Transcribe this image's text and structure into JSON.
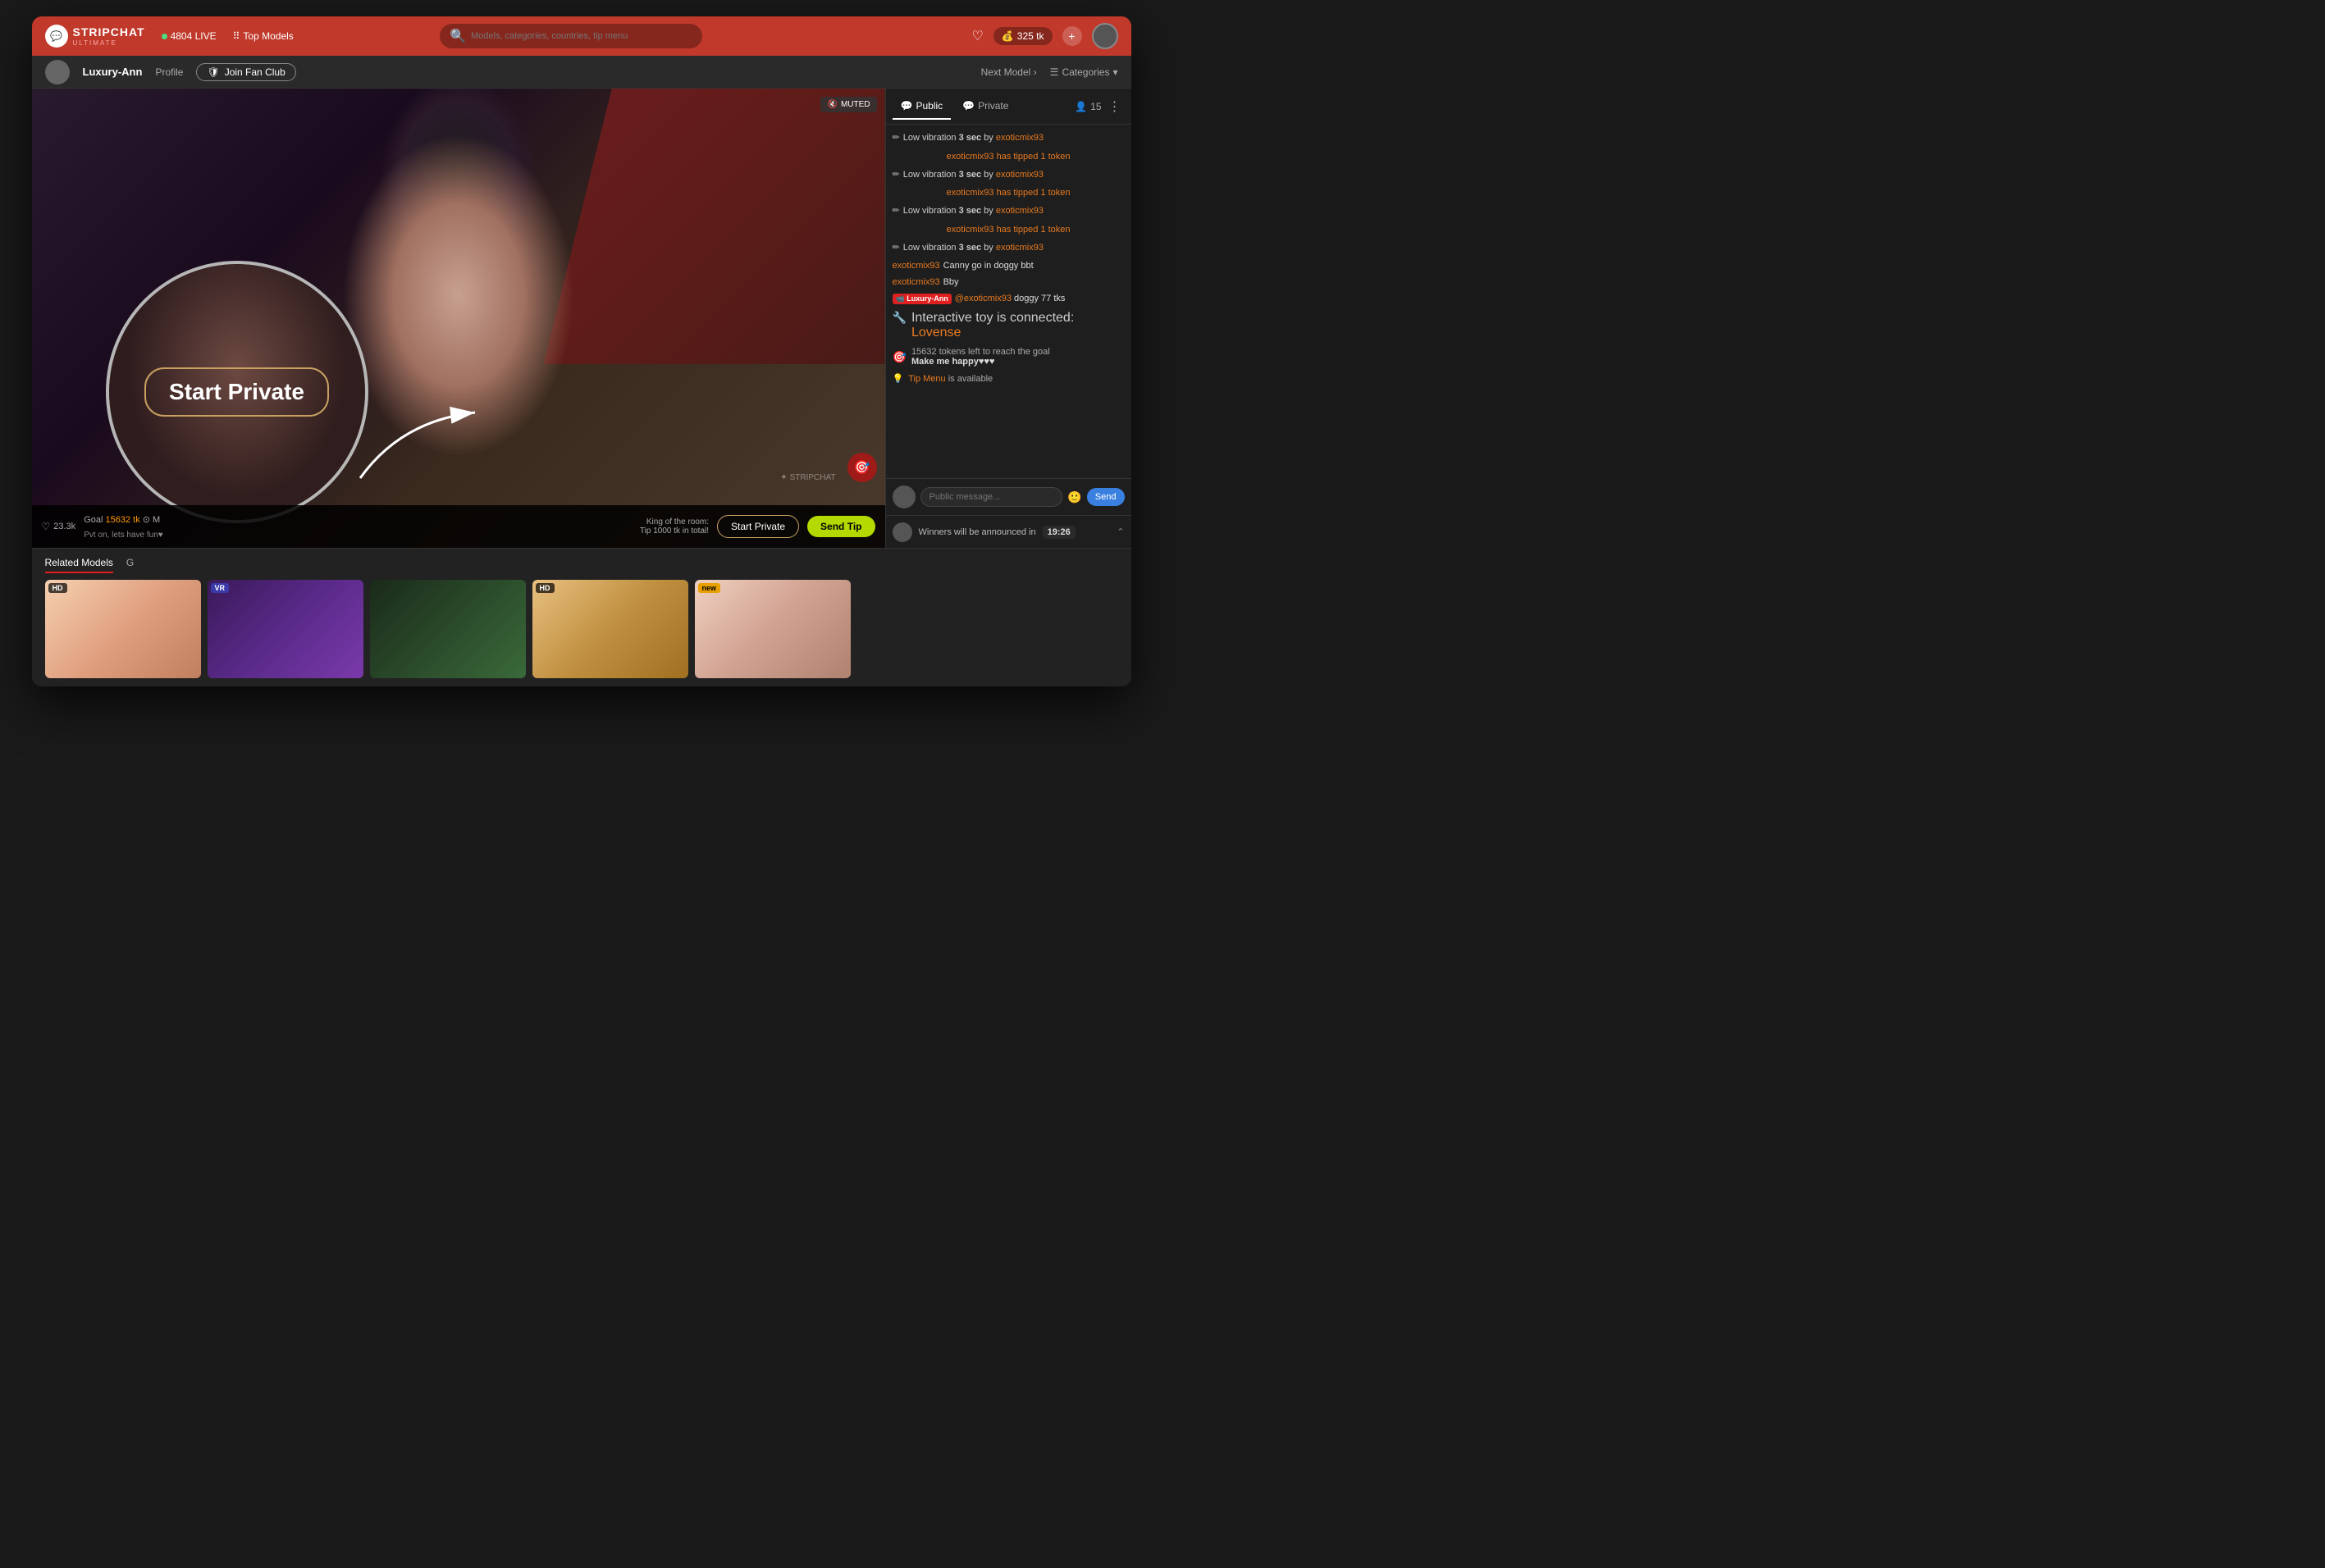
{
  "app": {
    "title": "STRIPCHAT",
    "subtitle": "ULTIMATE",
    "live_count": "4804 LIVE",
    "top_models": "Top Models",
    "search_placeholder": "Models, categories, countries, tip menu",
    "tokens": "325 tk",
    "model_name": "Luxury-Ann",
    "profile": "Profile",
    "join_fan_club": "Join Fan Club",
    "next_model": "Next Model",
    "categories": "Categories"
  },
  "video": {
    "muted_badge": "MUTED",
    "stripchat_watermark": "STRIPCHAT",
    "like_count": "23.3k",
    "goal_text": "Goal",
    "goal_tokens": "15632 tk",
    "goal_icon": "⊙ M",
    "pvt_text": "Pvt on, lets have fun♥",
    "start_private": "Start Private",
    "send_tip": "Send Tip",
    "king_line1": "King of the room:",
    "king_line2": "Tip 1000 tk in total!"
  },
  "circle_annotation": {
    "label": "Start Private"
  },
  "chat": {
    "tab_public": "Public",
    "tab_private": "Private",
    "tab_users_count": "15",
    "messages": [
      {
        "type": "vibration",
        "text": "Low vibration 3 sec by exoticmix93"
      },
      {
        "type": "tipped",
        "text": "exoticmix93 has tipped 1 token"
      },
      {
        "type": "vibration",
        "text": "Low vibration 3 sec by exoticmix93"
      },
      {
        "type": "tipped",
        "text": "exoticmix93 has tipped 1 token"
      },
      {
        "type": "vibration",
        "text": "Low vibration 3 sec by exoticmix93"
      },
      {
        "type": "tipped",
        "text": "exoticmix93 has tipped 1 token"
      },
      {
        "type": "vibration",
        "text": "Low vibration 3 sec by exoticmix93"
      },
      {
        "type": "chat",
        "user": "exoticmix93",
        "text": "Canny go in doggy bbt"
      },
      {
        "type": "chat",
        "user": "exoticmix93",
        "text": "Bby"
      },
      {
        "type": "model_chat",
        "model": "Luxury-Ann",
        "mention": "@exoticmix93",
        "text": " doggy 77 tks"
      },
      {
        "type": "system",
        "text": "Interactive toy is connected:",
        "link": "Lovense"
      },
      {
        "type": "goal",
        "tokens": "15632",
        "text": "tokens left to reach the goal",
        "bold": "Make me happy♥♥♥"
      },
      {
        "type": "tip_menu",
        "link": "Tip Menu",
        "text": "is available"
      }
    ],
    "input_placeholder": "Public message...",
    "send_label": "Send"
  },
  "winners": {
    "text": "Winners will be announced in",
    "timer": "19:26"
  },
  "related": {
    "tab_models": "Related Models",
    "tab_g": "G",
    "cards": [
      {
        "badge": "HD"
      },
      {
        "badge": "VR"
      },
      {},
      {
        "badge": "HD"
      },
      {
        "badge": "new"
      }
    ]
  }
}
